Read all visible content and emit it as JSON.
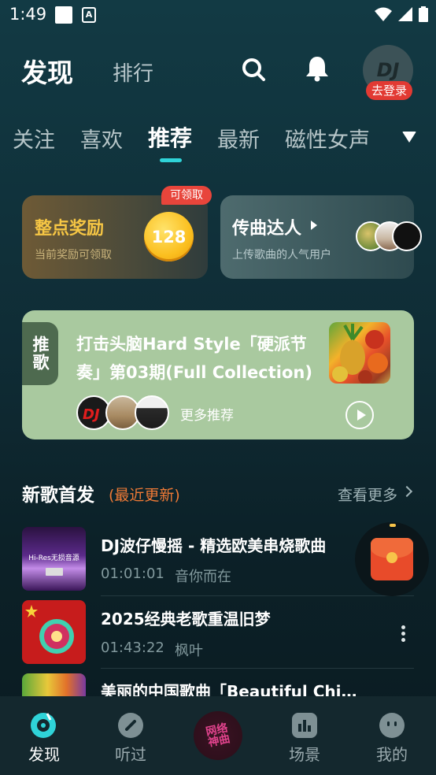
{
  "status_bar": {
    "time": "1:49"
  },
  "header": {
    "discover": "发现",
    "rank": "排行",
    "avatar_text": "DJ",
    "login_badge": "去登录"
  },
  "tabs": [
    {
      "label": "关注"
    },
    {
      "label": "喜欢"
    },
    {
      "label": "推荐",
      "active": true
    },
    {
      "label": "最新"
    },
    {
      "label": "磁性女声"
    }
  ],
  "reward_card": {
    "title": "整点奖励",
    "subtitle": "当前奖励可领取",
    "coin_value": "128",
    "claim_badge": "可领取"
  },
  "uploader_card": {
    "title": "传曲达人",
    "subtitle": "上传歌曲的人气用户"
  },
  "recommend_card": {
    "tag": "推歌",
    "title": "打击头脑Hard Style「硬派节奏」第03期(Full Collection)",
    "more_label": "更多推荐"
  },
  "new_songs": {
    "title": "新歌首发",
    "subtitle": "(最近更新)",
    "see_more": "查看更多",
    "items": [
      {
        "title": "DJ波仔慢摇 - 精选欧美串烧歌曲",
        "duration": "01:01:01",
        "artist": "音你而在",
        "cover_text": "Hi-Res无损音源"
      },
      {
        "title": "2025经典老歌重温旧梦",
        "duration": "01:43:22",
        "artist": "枫叶"
      },
      {
        "title": "美丽的中国歌曲「Beautiful Chinese Songs」"
      }
    ]
  },
  "bottom_nav": {
    "items": [
      {
        "label": "发现",
        "active": true
      },
      {
        "label": "听过"
      },
      {
        "label": "场景"
      },
      {
        "label": "我的"
      }
    ],
    "center_disc_text": "网络神曲"
  },
  "colors": {
    "accent": "#2fd3d8",
    "badge_red": "#e23a33",
    "orange": "#ef7a36",
    "gold": "#f6c644"
  }
}
